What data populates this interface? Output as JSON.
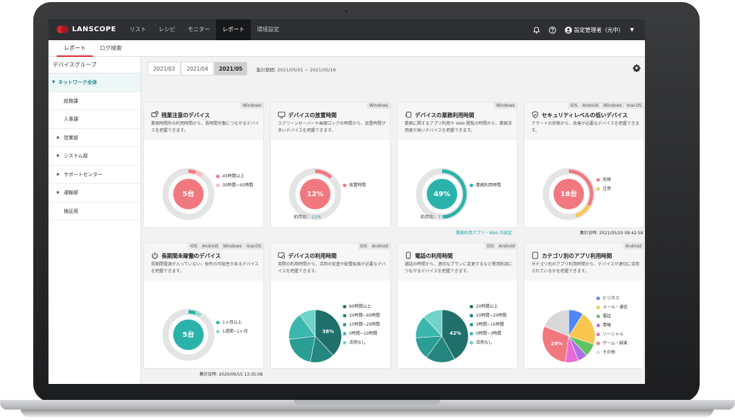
{
  "app": {
    "logo": "LANSCOPE"
  },
  "nav": {
    "items": [
      "リスト",
      "レシピ",
      "モニター",
      "レポート",
      "環境設定"
    ],
    "active": "レポート"
  },
  "header": {
    "user": "設定管理者（元中）"
  },
  "subtabs": {
    "items": [
      "レポート",
      "ログ検索"
    ],
    "active": "レポート"
  },
  "sidebar": {
    "title": "デバイスグループ",
    "root": "ネットワーク全体",
    "items": [
      "総務課",
      "人事課",
      "営業部",
      "システム部",
      "サポートセンター",
      "運輸部",
      "検証用"
    ]
  },
  "months": {
    "items": [
      "2021/03",
      "2021/04",
      "2021/05"
    ],
    "active": "2021/05"
  },
  "period": "集計期間: 2021/05/01 ~ 2021/05/19",
  "cards": [
    {
      "os": [
        "Windows"
      ],
      "icon": "overtime-icon",
      "title": "残業注意のデバイス",
      "desc": "業務時間外の利用時間から、長時間労働につながるデバイスを把握できます。",
      "center": "5台",
      "legend": [
        "45時間以上",
        "30時間~45時間"
      ],
      "colors": [
        "#f27880",
        "#f7b9bd"
      ],
      "values": [
        0.05,
        0.05
      ]
    },
    {
      "os": [
        "Windows"
      ],
      "icon": "monitor-icon",
      "title": "デバイスの放置時間",
      "desc": "スクリーンセーバーや画面ロックの時間から、放置時間が多いデバイスを把握できます。",
      "center": "12%",
      "legend": [
        "放置時間"
      ],
      "colors": [
        "#f27880"
      ],
      "values": [
        0.12
      ],
      "mom_label": "前月比：",
      "mom_value": "↓1%"
    },
    {
      "os": [
        "Windows"
      ],
      "icon": "app-icon",
      "title": "デバイスの業務利用時間",
      "desc": "業務に関するアプリ利用や Web 閲覧の時間から、業務活用度が高いデバイスを把握できます。",
      "center": "49%",
      "legend": [
        "業務利用時間"
      ],
      "colors": [
        "#2bb3ab"
      ],
      "values": [
        0.49
      ],
      "mom_label": "前月比：",
      "mom_value": "↑3%",
      "link": "業務利用アプリ・Web の設定"
    },
    {
      "os": [
        "iOS",
        "Android",
        "Windows",
        "macOS"
      ],
      "icon": "shield-icon",
      "title": "セキュリティレベルの低いデバイス",
      "desc": "アラートの状態から、改善が必要なデバイスを把握できます。",
      "center": "18台",
      "legend": [
        "危険",
        "注意"
      ],
      "colors": [
        "#f27880",
        "#f9c74f"
      ],
      "values": [
        0.33,
        0.12
      ],
      "agg": "集計日時: 2021/05/20 08:42:58"
    },
    {
      "os": [
        "iOS",
        "Android",
        "Windows",
        "macOS"
      ],
      "icon": "power-icon",
      "title": "長期間未稼働のデバイス",
      "desc": "長期間電源が入っていない、紛失の可能性があるデバイスを把握できます。",
      "center": "5台",
      "legend": [
        "1ヶ月以上",
        "1週間~1ヶ月"
      ],
      "colors": [
        "#2bb3ab",
        "#8fd9d2"
      ],
      "values": [
        0.05,
        0.04
      ],
      "agg": "集計日時: 2020/09/15 13:35:08"
    },
    {
      "os": [
        "iOS",
        "Android"
      ],
      "icon": "phone-icon",
      "title": "デバイスの利用時間",
      "desc": "実際の利用時間から、活用の促進や配置転換が必要なデバイスを把握できます。",
      "center": "38%",
      "legend": [
        "60時間以上",
        "20時間~60時間",
        "10時間~20時間",
        "0時間~10時間",
        "活用なし"
      ],
      "colors": [
        "#1f6f6b",
        "#25857f",
        "#2a9d95",
        "#3bb6ad",
        "#6fd3c9"
      ],
      "values": [
        0.38,
        0.15,
        0.2,
        0.17,
        0.1
      ]
    },
    {
      "os": [
        "iOS",
        "Android"
      ],
      "icon": "call-icon",
      "title": "電話の利用時間",
      "desc": "通話の時間から、適切なプランに変更するなど費用削減につながるデバイスを把握できます。",
      "center": "42%",
      "legend": [
        "20時間以上",
        "10時間~20時間",
        "3時間~10時間",
        "0時間~3時間",
        "活用なし"
      ],
      "colors": [
        "#1f6f6b",
        "#25857f",
        "#2a9d95",
        "#3bb6ad",
        "#6fd3c9"
      ],
      "values": [
        0.42,
        0.18,
        0.14,
        0.14,
        0.12
      ]
    },
    {
      "os": [
        "Android"
      ],
      "icon": "tablet-icon",
      "title": "カテゴリ別のアプリ利用時間",
      "desc": "カテゴリ別のアプリ利用時間から、デバイスが適切に活用されているかを把握できます。",
      "center": "29%",
      "legend": [
        "ビジネス",
        "メール・通信",
        "電話",
        "情報",
        "ソーシャル",
        "ゲーム・娯楽",
        "その他"
      ],
      "colors": [
        "#4f86f7",
        "#f9c74f",
        "#5fc35f",
        "#b070e0",
        "#e86ad6",
        "#f27880",
        "#d9d9d9"
      ],
      "values": [
        0.09,
        0.21,
        0.08,
        0.06,
        0.08,
        0.29,
        0.19
      ]
    }
  ]
}
